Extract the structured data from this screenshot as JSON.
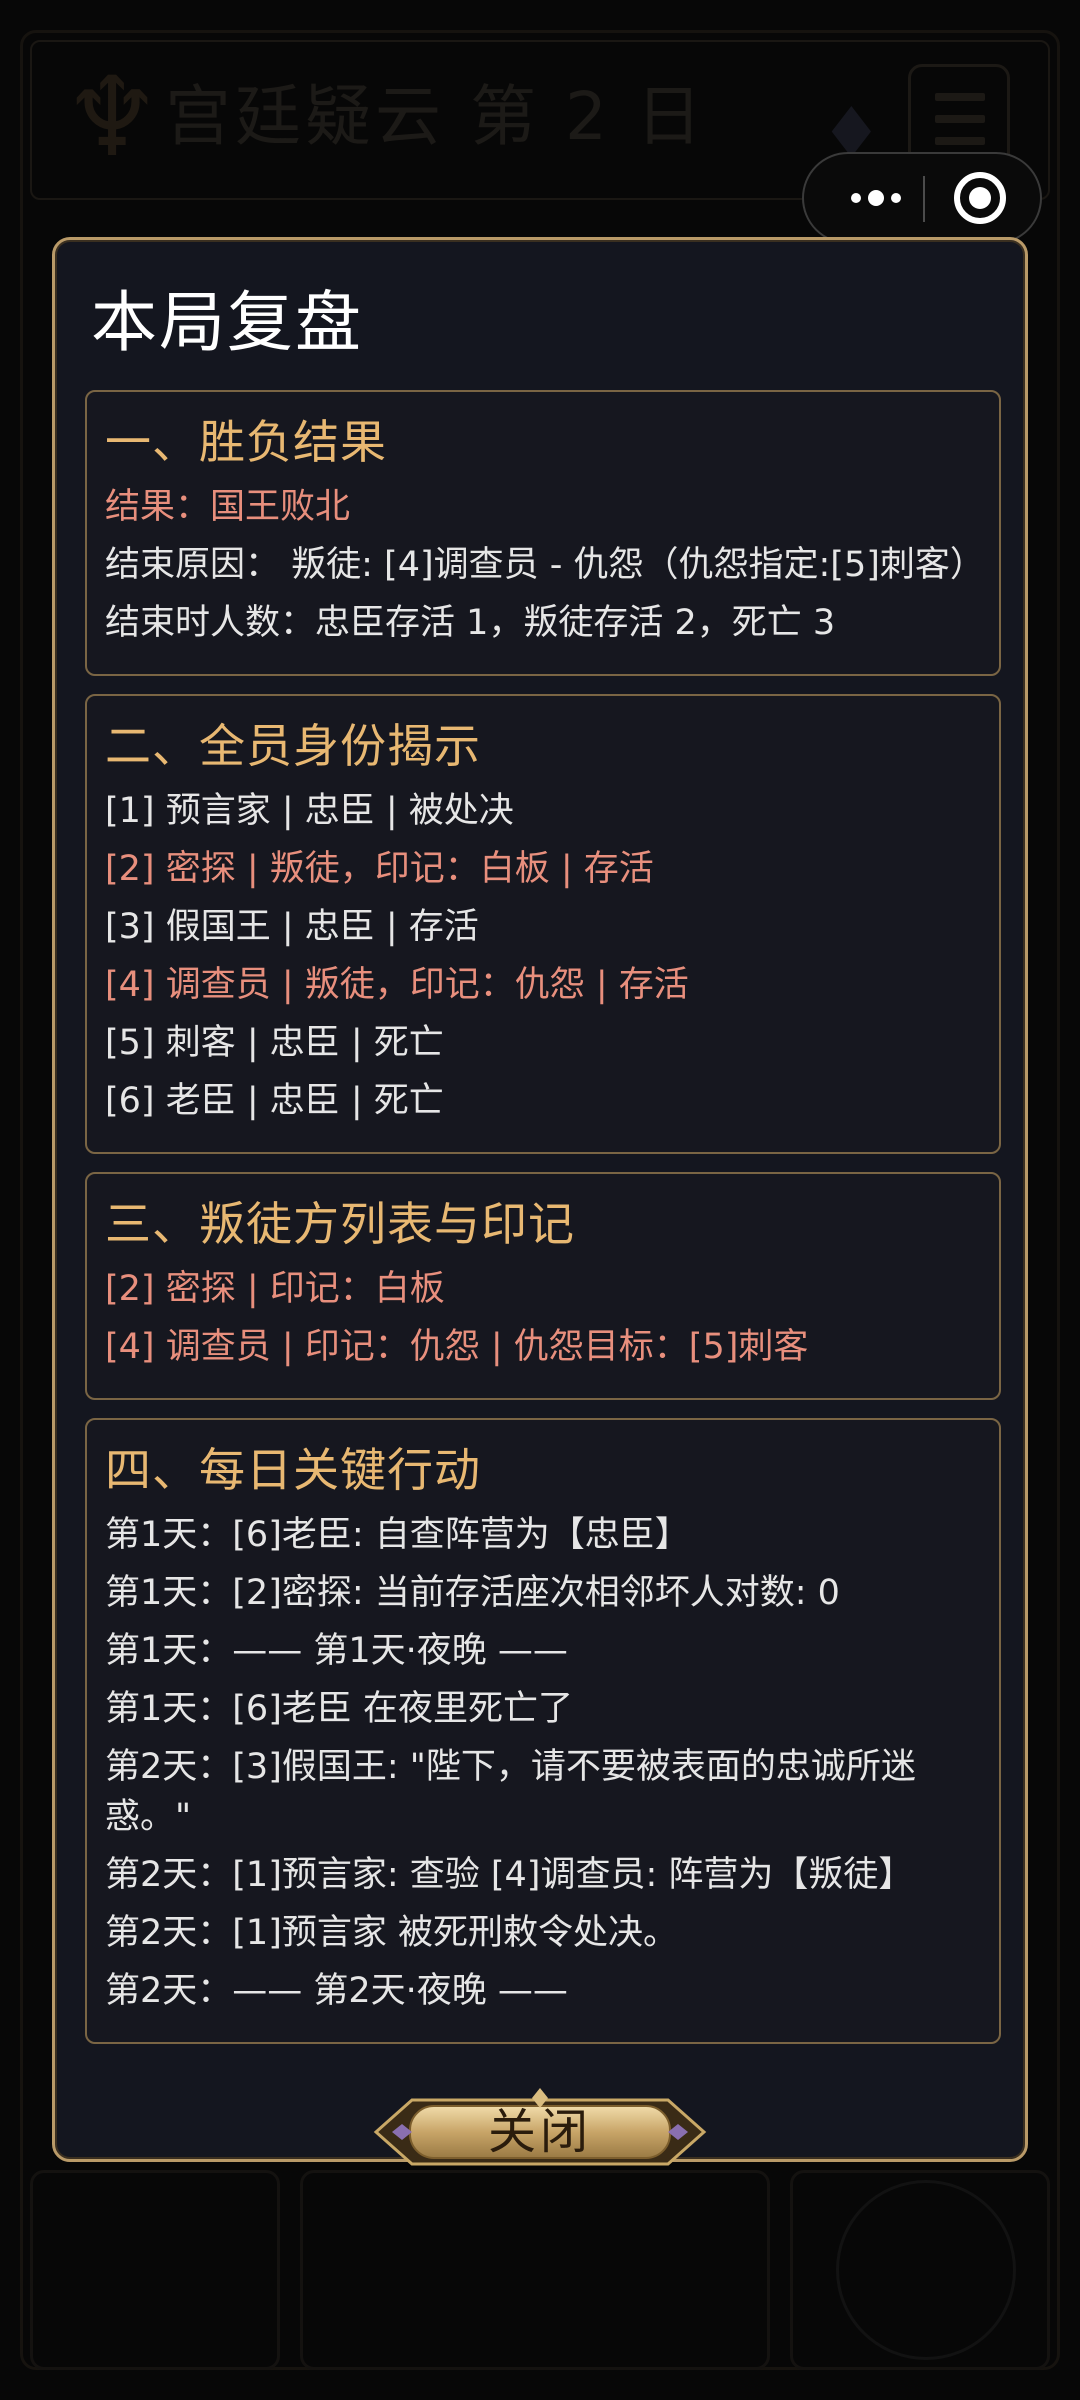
{
  "background": {
    "title": "宫廷疑云 第 2 日"
  },
  "modal": {
    "title": "本局复盘",
    "close_label": "关闭"
  },
  "sections": [
    {
      "heading": "一、胜负结果",
      "rows": [
        {
          "text": "结果：国王败北",
          "highlight": true
        },
        {
          "text": "结束原因：  叛徒: [4]调查员 - 仇怨（仇怨指定:[5]刺客）",
          "highlight": false
        },
        {
          "text": "结束时人数：忠臣存活 1，叛徒存活 2，死亡 3",
          "highlight": false
        }
      ]
    },
    {
      "heading": "二、全员身份揭示",
      "rows": [
        {
          "text": "[1] 预言家 | 忠臣 | 被处决",
          "highlight": false
        },
        {
          "text": "[2] 密探 | 叛徒，印记：白板 | 存活",
          "highlight": true
        },
        {
          "text": "[3] 假国王 | 忠臣 | 存活",
          "highlight": false
        },
        {
          "text": "[4] 调查员 | 叛徒，印记：仇怨 | 存活",
          "highlight": true
        },
        {
          "text": "[5] 刺客 | 忠臣 | 死亡",
          "highlight": false
        },
        {
          "text": "[6] 老臣 | 忠臣 | 死亡",
          "highlight": false
        }
      ]
    },
    {
      "heading": "三、叛徒方列表与印记",
      "rows": [
        {
          "text": "[2] 密探 | 印记：白板",
          "highlight": true
        },
        {
          "text": "[4] 调查员 | 印记：仇怨 | 仇怨目标：[5]刺客",
          "highlight": true
        }
      ]
    },
    {
      "heading": "四、每日关键行动",
      "rows": [
        {
          "text": "第1天：[6]老臣: 自查阵营为【忠臣】",
          "highlight": false
        },
        {
          "text": "第1天：[2]密探: 当前存活座次相邻坏人对数: 0",
          "highlight": false
        },
        {
          "text": "第1天：—— 第1天·夜晚 ——",
          "highlight": false
        },
        {
          "text": "第1天：[6]老臣 在夜里死亡了",
          "highlight": false
        },
        {
          "text": "第2天：[3]假国王: \"陛下，请不要被表面的忠诚所迷惑。\"",
          "highlight": false
        },
        {
          "text": "第2天：[1]预言家: 查验 [4]调查员: 阵营为【叛徒】",
          "highlight": false
        },
        {
          "text": "第2天：[1]预言家 被死刑敕令处决。",
          "highlight": false
        },
        {
          "text": "第2天：—— 第2天·夜晚 ——",
          "highlight": false
        }
      ]
    }
  ],
  "colors": {
    "accent_gold": "#e8b872",
    "highlight_red": "#e88f7d",
    "text": "#e6e6e6",
    "panel": "#14161f",
    "border": "#b99a68"
  },
  "icons": {
    "capsule_more": "more-dots-icon",
    "capsule_close": "target-close-icon"
  }
}
